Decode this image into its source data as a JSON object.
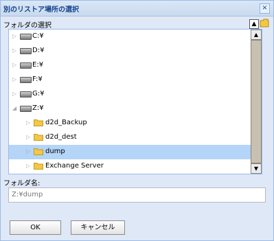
{
  "dialog": {
    "title": "別のリストア場所の選択",
    "close_glyph": "×"
  },
  "folder_section": {
    "label": "フォルダの選択",
    "up_glyph": "▲"
  },
  "tree": {
    "items": [
      {
        "label": "C:¥",
        "type": "drive",
        "expander": "▷"
      },
      {
        "label": "D:¥",
        "type": "drive",
        "expander": "▷"
      },
      {
        "label": "E:¥",
        "type": "drive",
        "expander": "▷"
      },
      {
        "label": "F:¥",
        "type": "drive",
        "expander": "▷"
      },
      {
        "label": "G:¥",
        "type": "drive",
        "expander": "▷"
      },
      {
        "label": "Z:¥",
        "type": "drive",
        "expander": "◢"
      },
      {
        "label": "d2d_Backup",
        "type": "folder",
        "expander": "▷"
      },
      {
        "label": "d2d_dest",
        "type": "folder",
        "expander": "▷"
      },
      {
        "label": "dump",
        "type": "folder",
        "expander": "▷",
        "selected": true
      },
      {
        "label": "Exchange Server",
        "type": "folder",
        "expander": "▷"
      }
    ],
    "scroll_up_glyph": "▲",
    "scroll_down_glyph": "▼"
  },
  "folder_name": {
    "label": "フォルダ名:",
    "value": "Z:¥dump"
  },
  "buttons": {
    "ok": "OK",
    "cancel": "キャンセル"
  },
  "colors": {
    "selection": "#b4d4f8",
    "folder": "#f5c842",
    "title_text": "#15428b"
  }
}
